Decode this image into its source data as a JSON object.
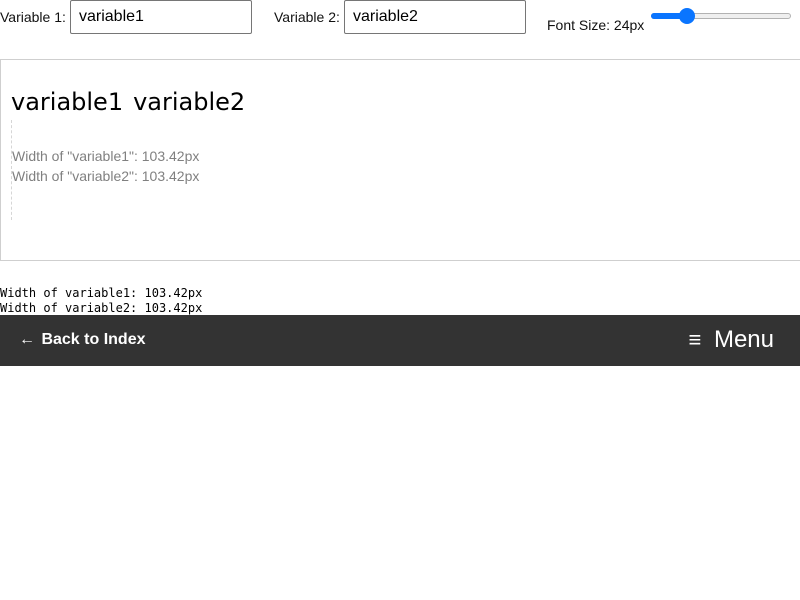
{
  "controls": {
    "variable1_label": "Variable 1:",
    "variable1_value": "variable1",
    "variable2_label": "Variable 2:",
    "variable2_value": "variable2",
    "font_size_label": "Font Size: 24px",
    "font_size_value": 24
  },
  "preview": {
    "word1": "variable1",
    "word2": "variable2",
    "measure1": "Width of \"variable1\": 103.42px",
    "measure2": "Width of \"variable2\": 103.42px"
  },
  "output": {
    "line1": "Width of variable1: 103.42px",
    "line2": "Width of variable2: 103.42px"
  },
  "nav": {
    "back_arrow": "←",
    "back_label": "Back to Index",
    "menu_icon": "≡",
    "menu_label": "Menu"
  },
  "colors": {
    "accent": "#0a75ff",
    "navbar": "#333333"
  }
}
